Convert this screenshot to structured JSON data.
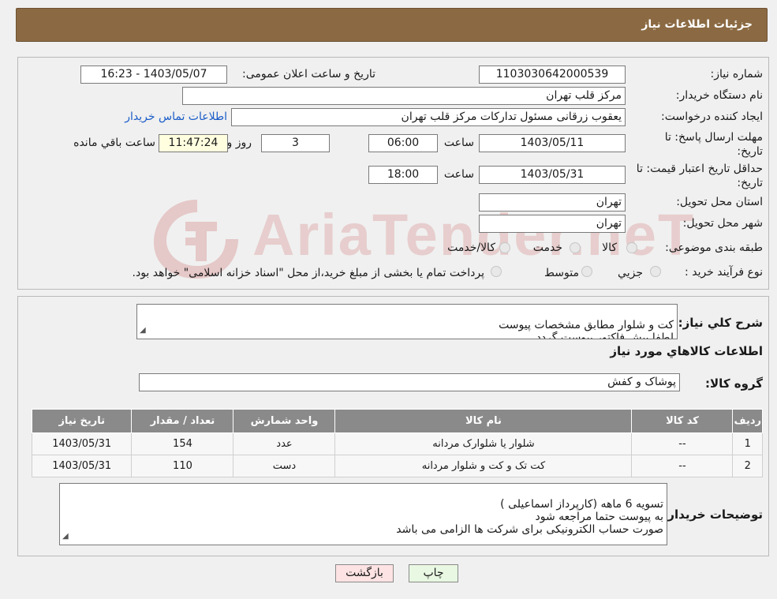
{
  "header": {
    "title": "جزئیات اطلاعات نیاز"
  },
  "form": {
    "need_number_label": "شماره نیاز:",
    "need_number": "1103030642000539",
    "announce_label": "تاریخ و ساعت اعلان عمومی:",
    "announce_value": "1403/05/07 - 16:23",
    "buyer_org_label": "نام دستگاه خریدار:",
    "buyer_org": "مرکز قلب تهران",
    "creator_label": "ایجاد کننده درخواست:",
    "creator": "یعقوب زرقانی مسئول تدارکات مرکز قلب تهران",
    "contact_link": "اطلاعات تماس خریدار",
    "deadline_label": "مهلت ارسال پاسخ: تا تاریخ:",
    "deadline_date": "1403/05/11",
    "time_label": "ساعت",
    "deadline_time": "06:00",
    "days_value": "3",
    "days_label": "روز و",
    "remaining_time": "11:47:24",
    "remaining_label": "ساعت باقي مانده",
    "validity_label": "حداقل تاریخ اعتبار قیمت: تا تاریخ:",
    "validity_date": "1403/05/31",
    "validity_time_label": "ساعت",
    "validity_time": "18:00",
    "province_label": "استان محل تحویل:",
    "province": "تهران",
    "city_label": "شهر محل تحویل:",
    "city": "تهران",
    "category_label": "طبقه بندی موضوعی:",
    "category_options": [
      "کالا",
      "خدمت",
      "کالا/خدمت"
    ],
    "purchase_label": "نوع فرآیند خرید :",
    "purchase_options": [
      "جزیي",
      "متوسط"
    ],
    "purchase_note": "پرداخت تمام یا بخشی از مبلغ خرید،از محل \"اسناد خزانه اسلامی\" خواهد بود."
  },
  "description": {
    "label": "شرح کلي نياز:",
    "text": "کت و شلوار مطابق مشخصات پیوست\nلطفا پیش فاکتور پیوست گردد"
  },
  "goods": {
    "section_title": "اطلاعات کالاهاي مورد نياز",
    "group_label": "گروه کالا:",
    "group_value": "پوشاک و کفش"
  },
  "table": {
    "headers": [
      "رديف",
      "کد کالا",
      "نام کالا",
      "واحد شمارش",
      "تعداد / مقدار",
      "تاريخ نياز"
    ],
    "rows": [
      [
        "1",
        "--",
        "شلوار یا شلوارک مردانه",
        "عدد",
        "154",
        "1403/05/31"
      ],
      [
        "2",
        "--",
        "کت تک و کت و شلوار مردانه",
        "دست",
        "110",
        "1403/05/31"
      ]
    ]
  },
  "buyer_notes": {
    "label": "توضیحات خریدار:",
    "text": "تسویه 6 ماهه (کارپرداز اسماعیلی )\nبه پیوست حتما مراجعه شود\nصورت حساب الکترونیکی برای شرکت ها الزامی می باشد"
  },
  "buttons": {
    "print": "چاپ",
    "back": "بازگشت"
  },
  "watermark": {
    "text": "AriaTender.neT"
  },
  "colors": {
    "header_bg": "#8b6a43",
    "link": "#1a5cc8",
    "back_button_bg": "#fde3e3",
    "print_button_bg": "#e8f8e2",
    "watermark": "#b30000"
  }
}
